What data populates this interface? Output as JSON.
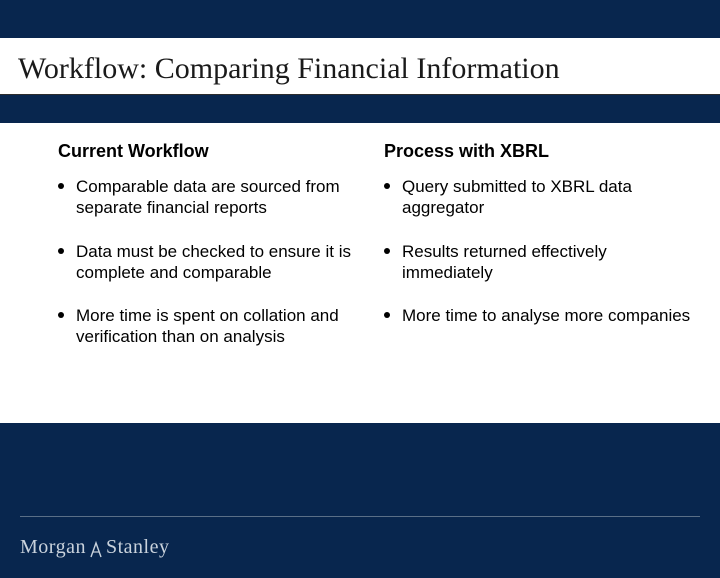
{
  "title": "Workflow: Comparing Financial Information",
  "columns": {
    "left": {
      "heading": "Current Workflow",
      "items": [
        "Comparable data are sourced from separate financial reports",
        "Data must be checked to ensure it is complete and comparable",
        "More time is spent on collation and verification than on analysis"
      ]
    },
    "right": {
      "heading": "Process with XBRL",
      "items": [
        "Query submitted to XBRL data aggregator",
        "Results returned effectively immediately",
        "More time to analyse more companies"
      ]
    }
  },
  "footer": {
    "logo_part1": "Morgan",
    "logo_part2": "Stanley"
  }
}
